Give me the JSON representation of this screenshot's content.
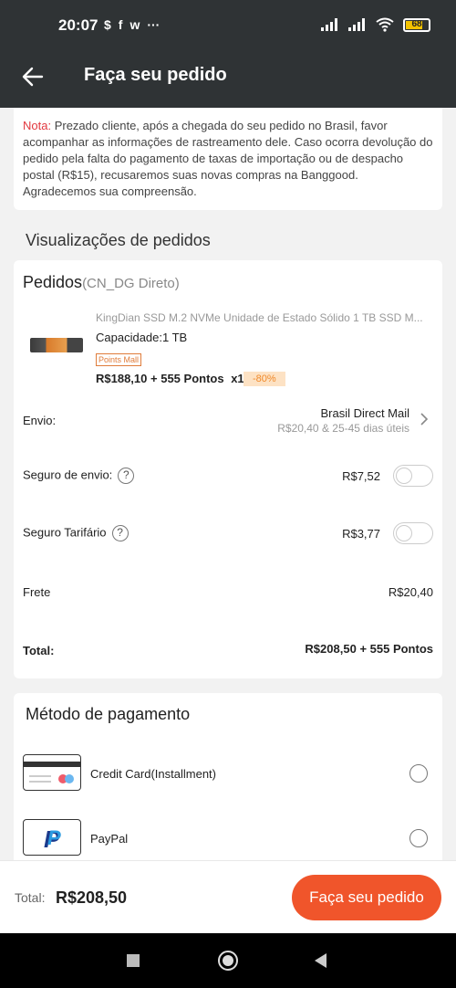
{
  "status_bar": {
    "time": "20:07",
    "app_icons": [
      "$",
      "f",
      "w",
      "···"
    ],
    "battery": "68"
  },
  "app_bar": {
    "title": "Faça seu pedido"
  },
  "notice": {
    "label": "Nota:",
    "text": " Prezado cliente, após a chegada do seu pedido no Brasil, favor acompanhar as informações de rastreamento dele. Caso ocorra devolução do pedido pela falta do pagamento de taxas de importação ou de despacho postal (R$15), recusaremos suas novas compras na Banggood. Agradecemos sua compreensão."
  },
  "orders_section": {
    "title": "Visualizações de pedidos"
  },
  "orders": {
    "heading": "Pedidos",
    "warehouse": "(CN_DG Direto)",
    "product": {
      "name": "KingDian SSD M.2 NVMe Unidade de Estado Sólido 1 TB SSD M...",
      "capacity": "Capacidade:1 TB",
      "badge": "Points Mall",
      "price": "R$188,10",
      "points": "+ 555 Pontos",
      "qty": "x1",
      "discount": "-80%"
    },
    "shipping": {
      "label": "Envio:",
      "method": "Brasil Direct Mail",
      "detail": "R$20,40 & 25-45 dias úteis"
    },
    "insurance": {
      "label": "Seguro de envio:",
      "value": "R$7,52",
      "enabled": false
    },
    "tariff": {
      "label": "Seguro Tarifário",
      "value": "R$3,77",
      "enabled": false
    },
    "freight": {
      "label": "Frete",
      "value": "R$20,40"
    },
    "total": {
      "label": "Total:",
      "value": "R$208,50",
      "points": "+ 555 Pontos"
    }
  },
  "payment": {
    "title": "Método de pagamento",
    "methods": [
      {
        "label": "Credit Card(Installment)",
        "icon": "credit-card-icon"
      },
      {
        "label": "PayPal",
        "icon": "paypal-icon"
      }
    ]
  },
  "bottom": {
    "total_label": "Total:",
    "total_value": "R$208,50",
    "button": "Faça seu pedido"
  }
}
